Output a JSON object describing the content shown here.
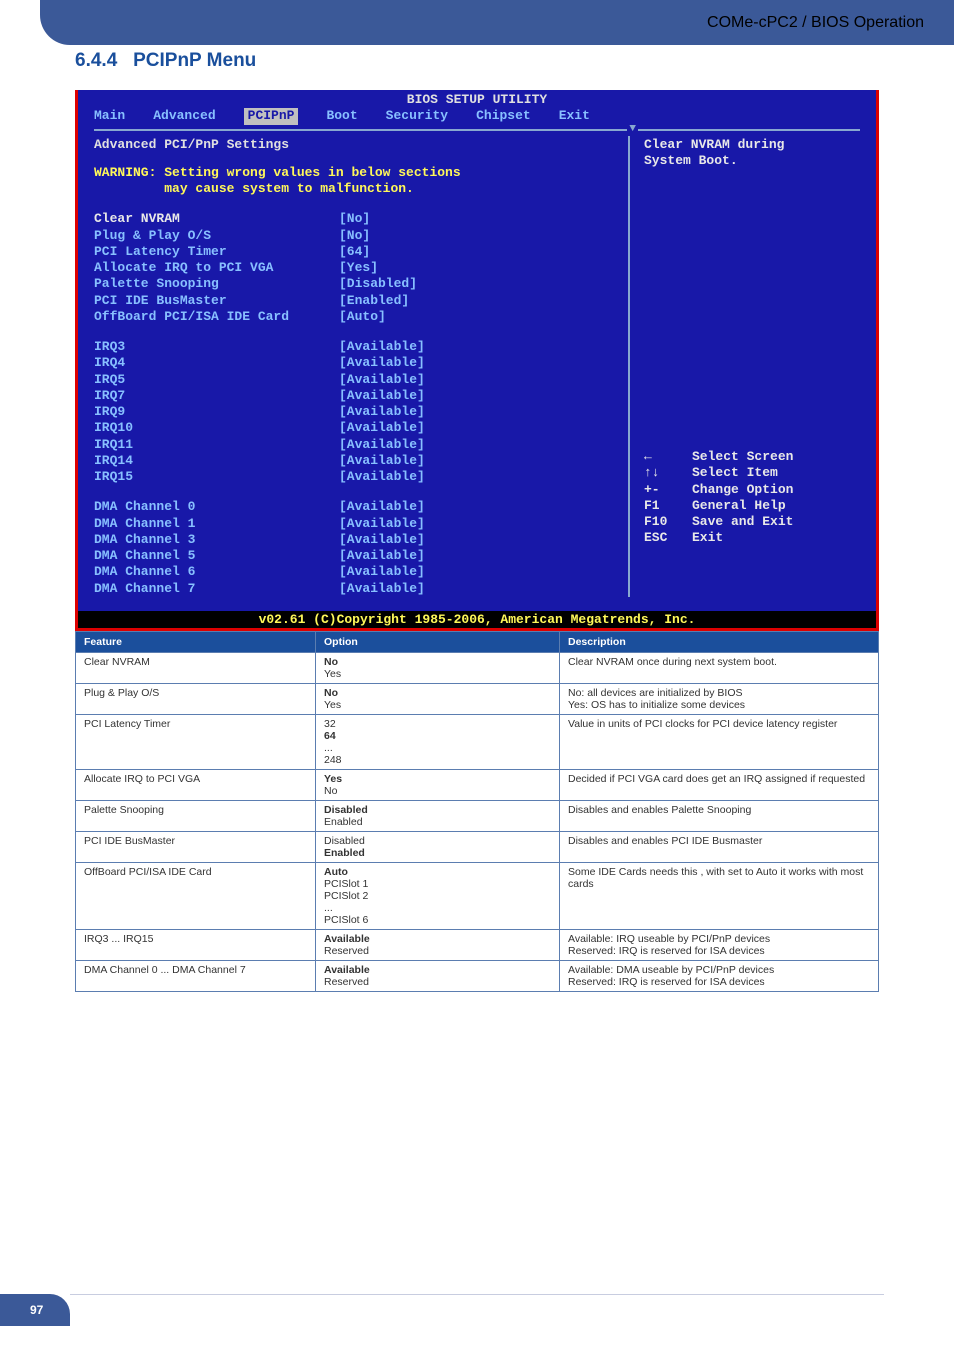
{
  "header": {
    "breadcrumb": "COMe-cPC2 / BIOS Operation"
  },
  "section": {
    "number": "6.4.4",
    "title": "PCIPnP Menu"
  },
  "bios": {
    "title": "BIOS SETUP UTILITY",
    "tabs": [
      "Main",
      "Advanced",
      "PCIPnP",
      "Boot",
      "Security",
      "Chipset",
      "Exit"
    ],
    "selected_tab": "PCIPnP",
    "panel_heading": "Advanced PCI/PnP Settings",
    "warning_l1": "WARNING: Setting wrong values in below sections",
    "warning_l2": "         may cause system to malfunction.",
    "rows1": [
      {
        "label": "Clear NVRAM",
        "value": "[No]",
        "highlight": true
      },
      {
        "label": "Plug & Play O/S",
        "value": "[No]"
      },
      {
        "label": "PCI Latency Timer",
        "value": "[64]"
      },
      {
        "label": "Allocate IRQ to PCI VGA",
        "value": "[Yes]"
      },
      {
        "label": "Palette Snooping",
        "value": "[Disabled]"
      },
      {
        "label": "PCI IDE BusMaster",
        "value": "[Enabled]"
      },
      {
        "label": "OffBoard PCI/ISA IDE Card",
        "value": "[Auto]"
      }
    ],
    "rows2": [
      {
        "label": "IRQ3",
        "value": "[Available]"
      },
      {
        "label": "IRQ4",
        "value": "[Available]"
      },
      {
        "label": "IRQ5",
        "value": "[Available]"
      },
      {
        "label": "IRQ7",
        "value": "[Available]"
      },
      {
        "label": "IRQ9",
        "value": "[Available]"
      },
      {
        "label": "IRQ10",
        "value": "[Available]"
      },
      {
        "label": "IRQ11",
        "value": "[Available]"
      },
      {
        "label": "IRQ14",
        "value": "[Available]"
      },
      {
        "label": "IRQ15",
        "value": "[Available]"
      }
    ],
    "rows3": [
      {
        "label": "DMA Channel 0",
        "value": "[Available]"
      },
      {
        "label": "DMA Channel 1",
        "value": "[Available]"
      },
      {
        "label": "DMA Channel 3",
        "value": "[Available]"
      },
      {
        "label": "DMA Channel 5",
        "value": "[Available]"
      },
      {
        "label": "DMA Channel 6",
        "value": "[Available]"
      },
      {
        "label": "DMA Channel 7",
        "value": "[Available]"
      }
    ],
    "help_l1": "Clear NVRAM during",
    "help_l2": "System Boot.",
    "nav": [
      {
        "key": "←",
        "text": "Select Screen"
      },
      {
        "key": "↑↓",
        "text": "Select Item"
      },
      {
        "key": "+-",
        "text": "Change Option"
      },
      {
        "key": "F1",
        "text": "General Help"
      },
      {
        "key": "F10",
        "text": "Save and Exit"
      },
      {
        "key": "ESC",
        "text": "Exit"
      }
    ],
    "footer": "v02.61 (C)Copyright 1985-2006, American Megatrends, Inc."
  },
  "table": {
    "headers": [
      "Feature",
      "Option",
      "Description"
    ],
    "rows": [
      {
        "feature": "Clear NVRAM",
        "options": [
          {
            "t": "No",
            "d": true
          },
          {
            "t": "Yes"
          }
        ],
        "desc": "Clear NVRAM once during next system boot."
      },
      {
        "feature": "Plug & Play O/S",
        "options": [
          {
            "t": "No",
            "d": true
          },
          {
            "t": "Yes"
          }
        ],
        "desc": "No: all devices are initialized by BIOS\nYes: OS has to initialize some devices"
      },
      {
        "feature": "PCI Latency Timer",
        "options": [
          {
            "t": "32"
          },
          {
            "t": "64",
            "d": true
          },
          {
            "t": "..."
          },
          {
            "t": "248"
          }
        ],
        "desc": "Value in units of PCI clocks for PCI device latency register"
      },
      {
        "feature": "Allocate IRQ to PCI VGA",
        "options": [
          {
            "t": "Yes",
            "d": true
          },
          {
            "t": "No"
          }
        ],
        "desc": "Decided if PCI VGA card does get an IRQ assigned if requested"
      },
      {
        "feature": "Palette Snooping",
        "options": [
          {
            "t": "Disabled",
            "d": true
          },
          {
            "t": "Enabled"
          }
        ],
        "desc": "Disables and enables Palette Snooping"
      },
      {
        "feature": "PCI IDE BusMaster",
        "options": [
          {
            "t": "Disabled"
          },
          {
            "t": "Enabled",
            "d": true
          }
        ],
        "desc": "Disables and enables PCI IDE Busmaster"
      },
      {
        "feature": "OffBoard PCI/ISA IDE Card",
        "options": [
          {
            "t": "Auto",
            "d": true
          },
          {
            "t": "PCISlot 1"
          },
          {
            "t": "PCISlot 2"
          },
          {
            "t": "..."
          },
          {
            "t": "PCISlot 6"
          }
        ],
        "desc": "Some IDE Cards needs this , with set to Auto it works with most cards"
      },
      {
        "feature": "IRQ3 ... IRQ15",
        "options": [
          {
            "t": "Available",
            "d": true
          },
          {
            "t": "Reserved"
          }
        ],
        "desc": "Available: IRQ useable by PCI/PnP devices\nReserved: IRQ is reserved for ISA devices"
      },
      {
        "feature": "DMA Channel 0 ... DMA Channel 7",
        "options": [
          {
            "t": "Available",
            "d": true
          },
          {
            "t": "Reserved"
          }
        ],
        "desc": "Available: DMA useable by PCI/PnP devices\nReserved: IRQ is reserved for ISA devices"
      }
    ]
  },
  "page_number": "97"
}
